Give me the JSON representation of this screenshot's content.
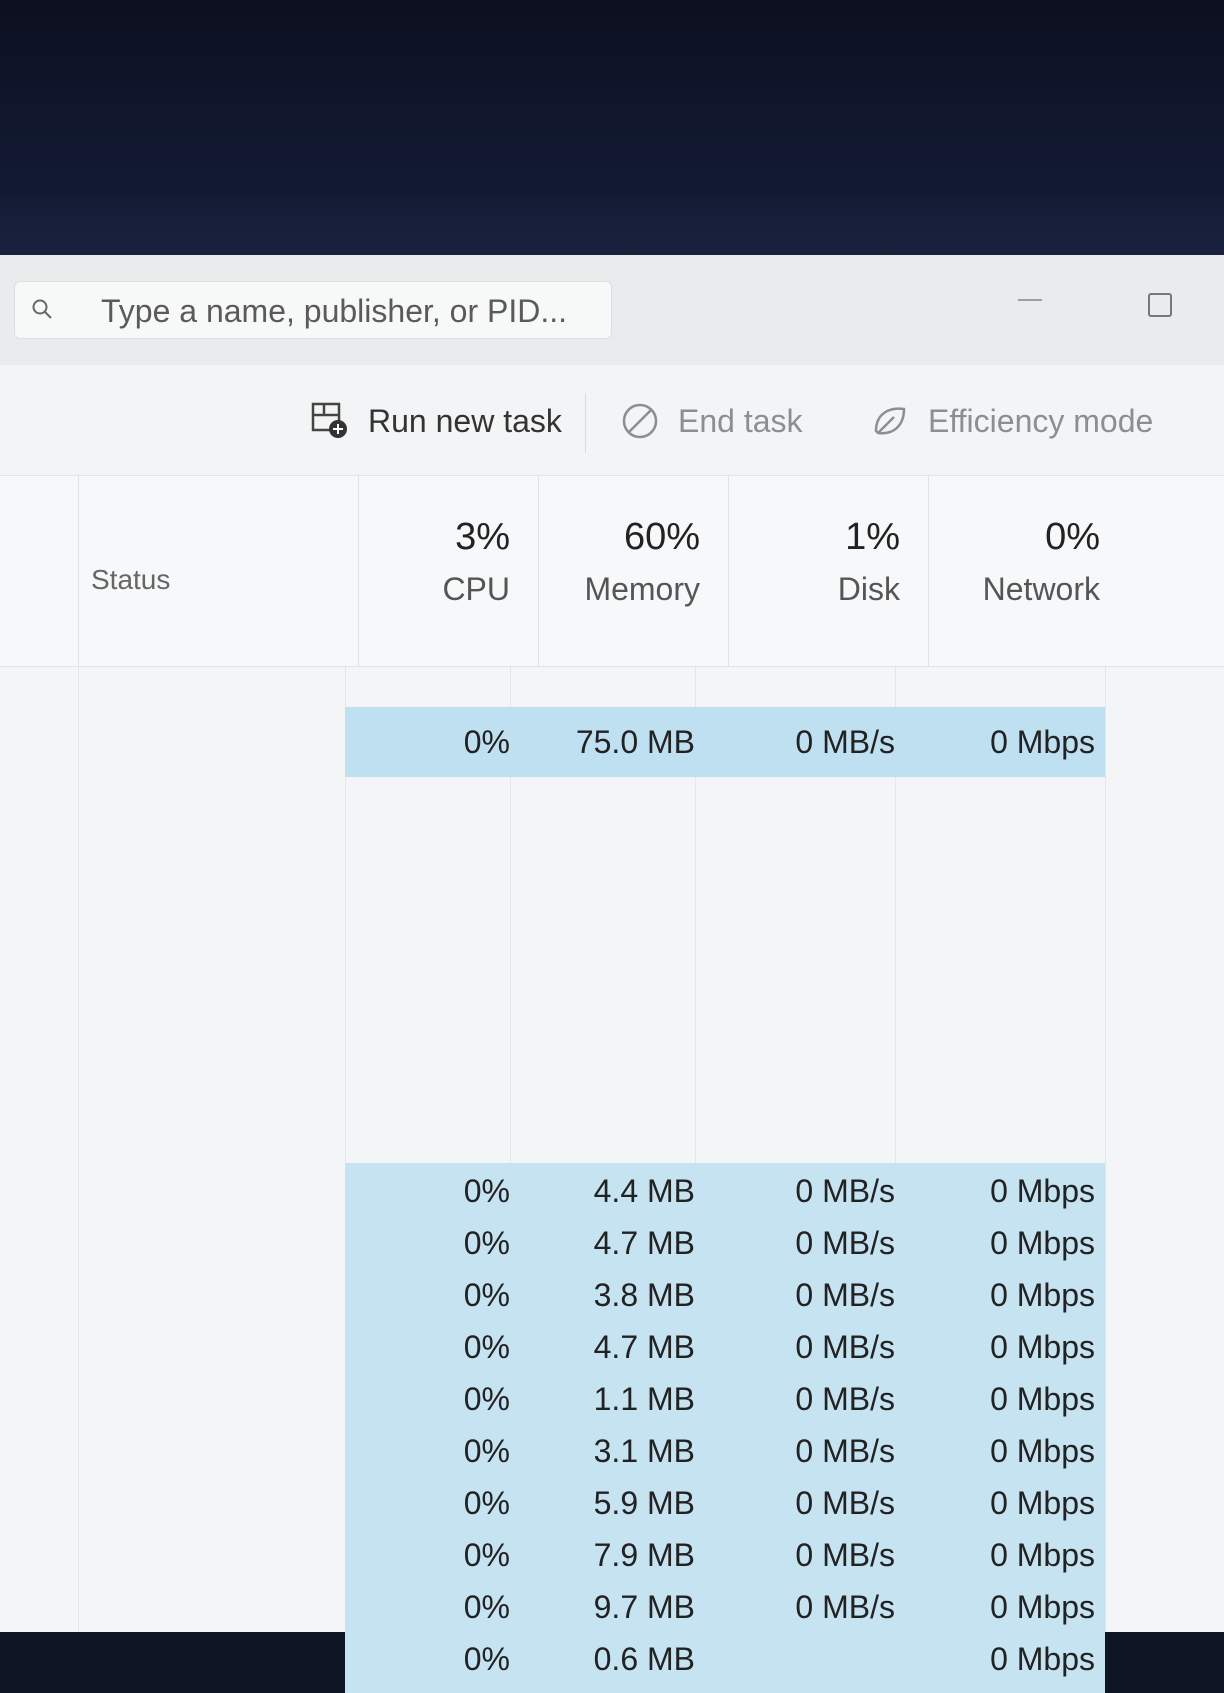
{
  "search": {
    "placeholder": "Type a name, publisher, or PID..."
  },
  "toolbar": {
    "run_new_task": "Run new task",
    "end_task": "End task",
    "efficiency_mode": "Efficiency mode"
  },
  "columns": {
    "status": "Status",
    "cpu": {
      "pct": "3%",
      "label": "CPU"
    },
    "memory": {
      "pct": "60%",
      "label": "Memory"
    },
    "disk": {
      "pct": "1%",
      "label": "Disk"
    },
    "network": {
      "pct": "0%",
      "label": "Network"
    }
  },
  "rows": [
    {
      "cpu": "0%",
      "memory": "75.0 MB",
      "disk": "0 MB/s",
      "network": "0 Mbps"
    },
    {
      "cpu": "0%",
      "memory": "4.4 MB",
      "disk": "0 MB/s",
      "network": "0 Mbps"
    },
    {
      "cpu": "0%",
      "memory": "4.7 MB",
      "disk": "0 MB/s",
      "network": "0 Mbps"
    },
    {
      "cpu": "0%",
      "memory": "3.8 MB",
      "disk": "0 MB/s",
      "network": "0 Mbps"
    },
    {
      "cpu": "0%",
      "memory": "4.7 MB",
      "disk": "0 MB/s",
      "network": "0 Mbps"
    },
    {
      "cpu": "0%",
      "memory": "1.1 MB",
      "disk": "0 MB/s",
      "network": "0 Mbps"
    },
    {
      "cpu": "0%",
      "memory": "3.1 MB",
      "disk": "0 MB/s",
      "network": "0 Mbps"
    },
    {
      "cpu": "0%",
      "memory": "5.9 MB",
      "disk": "0 MB/s",
      "network": "0 Mbps"
    },
    {
      "cpu": "0%",
      "memory": "7.9 MB",
      "disk": "0 MB/s",
      "network": "0 Mbps"
    },
    {
      "cpu": "0%",
      "memory": "9.7 MB",
      "disk": "0 MB/s",
      "network": "0 Mbps"
    },
    {
      "cpu": "0%",
      "memory": "0.6 MB",
      "disk": "",
      "network": "0 Mbps"
    }
  ],
  "colors": {
    "highlight": "#bfe0f0",
    "window_bg": "#f4f5f6",
    "bezel": "#0f1424"
  }
}
